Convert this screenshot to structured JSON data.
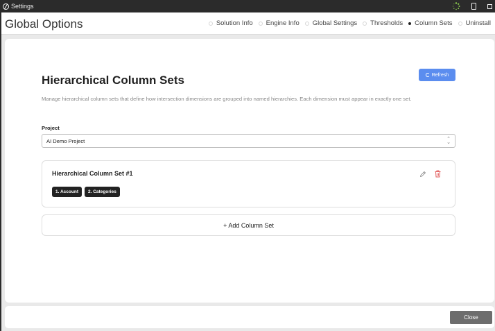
{
  "window": {
    "title": "Settings"
  },
  "header": {
    "title": "Global Options",
    "nav": [
      {
        "label": "Solution Info",
        "active": false
      },
      {
        "label": "Engine Info",
        "active": false
      },
      {
        "label": "Global Settings",
        "active": false
      },
      {
        "label": "Thresholds",
        "active": false
      },
      {
        "label": "Column Sets",
        "active": true
      },
      {
        "label": "Uninstall",
        "active": false
      }
    ]
  },
  "main": {
    "title": "Hierarchical Column Sets",
    "refresh_label": "Refresh",
    "description": "Manage hierarchical column sets that define how intersection dimensions are grouped into named hierarchies. Each dimension must appear in exactly one set.",
    "project_label": "Project",
    "project_value": "AI Demo Project",
    "column_sets": [
      {
        "title": "Hierarchical Column Set #1",
        "dimensions": [
          "1. Account",
          "2. Categories"
        ]
      }
    ],
    "add_label": "+ Add Column Set"
  },
  "footer": {
    "close_label": "Close"
  },
  "colors": {
    "accent": "#5b8def",
    "chip": "#222222",
    "delete": "#e05555"
  },
  "icons": [
    "app-icon",
    "loader-icon",
    "document-icon",
    "maximize-icon",
    "refresh-icon",
    "chevron-updown-icon",
    "pencil-icon",
    "trash-icon"
  ]
}
